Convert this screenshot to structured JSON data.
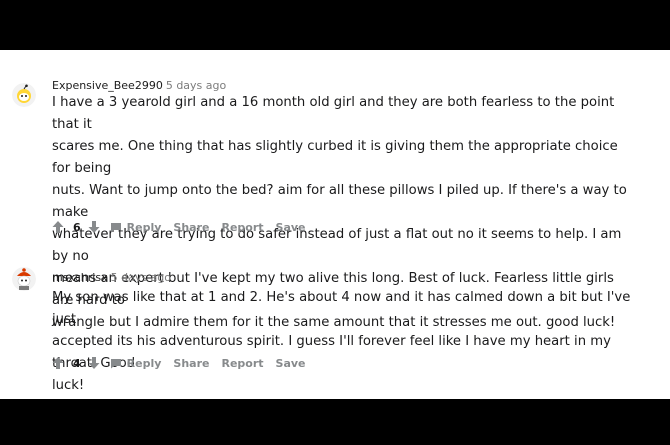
{
  "comments": [
    {
      "username": "Expensive_Bee2990",
      "time": "5 days ago",
      "lines": [
        "I have a 3 yearold girl and a 16 month old girl and they are both fearless to the point that it",
        "scares me. One thing that has slightly curbed it is giving them the appropriate choice for being",
        "nuts. Want to jump onto the bed? aim for all these pillows I piled up. If there's a way to make",
        "whatever they are trying to do safer instead of just a flat out no it seems to help. I am by no",
        "means an expert but I've kept my two alive this long. Best of luck. Fearless little girls are hard to",
        "wrangle but I admire them for it the same amount that it stresses me out. good luck!"
      ],
      "score": "6",
      "avatar_icon": "snoo-avatar-yellow"
    },
    {
      "username": "msxchrisx",
      "time": "5 days ago",
      "lines": [
        "My son was like that at 1 and 2. He's about 4 now and it has calmed down a bit but I've just",
        "accepted its his adventurous spirit. I guess I'll forever feel like I have my heart in my throat. Good",
        "luck!"
      ],
      "score": "4",
      "avatar_icon": "snoo-avatar-red-hat"
    }
  ],
  "actions": {
    "reply": "Reply",
    "share": "Share",
    "report": "Report",
    "save": "Save"
  },
  "colors": {
    "background": "#000000",
    "panel": "#ffffff",
    "text": "#1a1a1b",
    "muted": "#878a8c"
  }
}
